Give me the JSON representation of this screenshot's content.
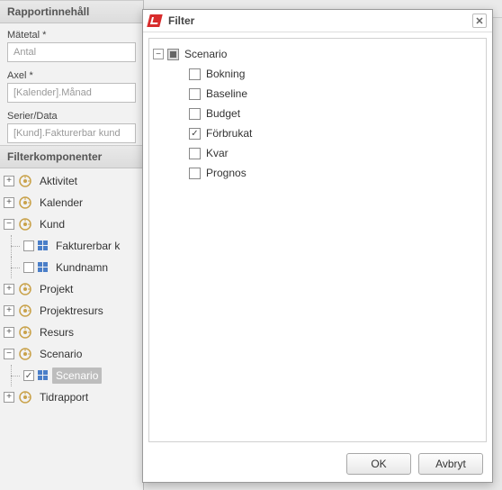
{
  "left": {
    "content_header": "Rapportinnehåll",
    "fields": [
      {
        "label": "Mätetal *",
        "placeholder": "Antal"
      },
      {
        "label": "Axel *",
        "placeholder": "[Kalender].Månad"
      },
      {
        "label": "Serier/Data",
        "placeholder": "[Kund].Fakturerbar kund"
      }
    ],
    "filter_header": "Filterkomponenter",
    "tree": [
      {
        "label": "Aktivitet",
        "expandable": true,
        "expanded": false
      },
      {
        "label": "Kalender",
        "expandable": true,
        "expanded": false
      },
      {
        "label": "Kund",
        "expandable": true,
        "expanded": true,
        "children": [
          {
            "label": "Fakturerbar k",
            "checked": false
          },
          {
            "label": "Kundnamn",
            "checked": false
          }
        ]
      },
      {
        "label": "Projekt",
        "expandable": true,
        "expanded": false
      },
      {
        "label": "Projektresurs",
        "expandable": true,
        "expanded": false
      },
      {
        "label": "Resurs",
        "expandable": true,
        "expanded": false
      },
      {
        "label": "Scenario",
        "expandable": true,
        "expanded": true,
        "children": [
          {
            "label": "Scenario",
            "checked": true,
            "selected": true
          }
        ]
      },
      {
        "label": "Tidrapport",
        "expandable": true,
        "expanded": false
      }
    ]
  },
  "dialog": {
    "title": "Filter",
    "root": {
      "label": "Scenario",
      "state": "indeterminate"
    },
    "items": [
      {
        "label": "Bokning",
        "checked": false
      },
      {
        "label": "Baseline",
        "checked": false
      },
      {
        "label": "Budget",
        "checked": false
      },
      {
        "label": "Förbrukat",
        "checked": true
      },
      {
        "label": "Kvar",
        "checked": false
      },
      {
        "label": "Prognos",
        "checked": false
      }
    ],
    "buttons": {
      "ok": "OK",
      "cancel": "Avbryt"
    }
  }
}
